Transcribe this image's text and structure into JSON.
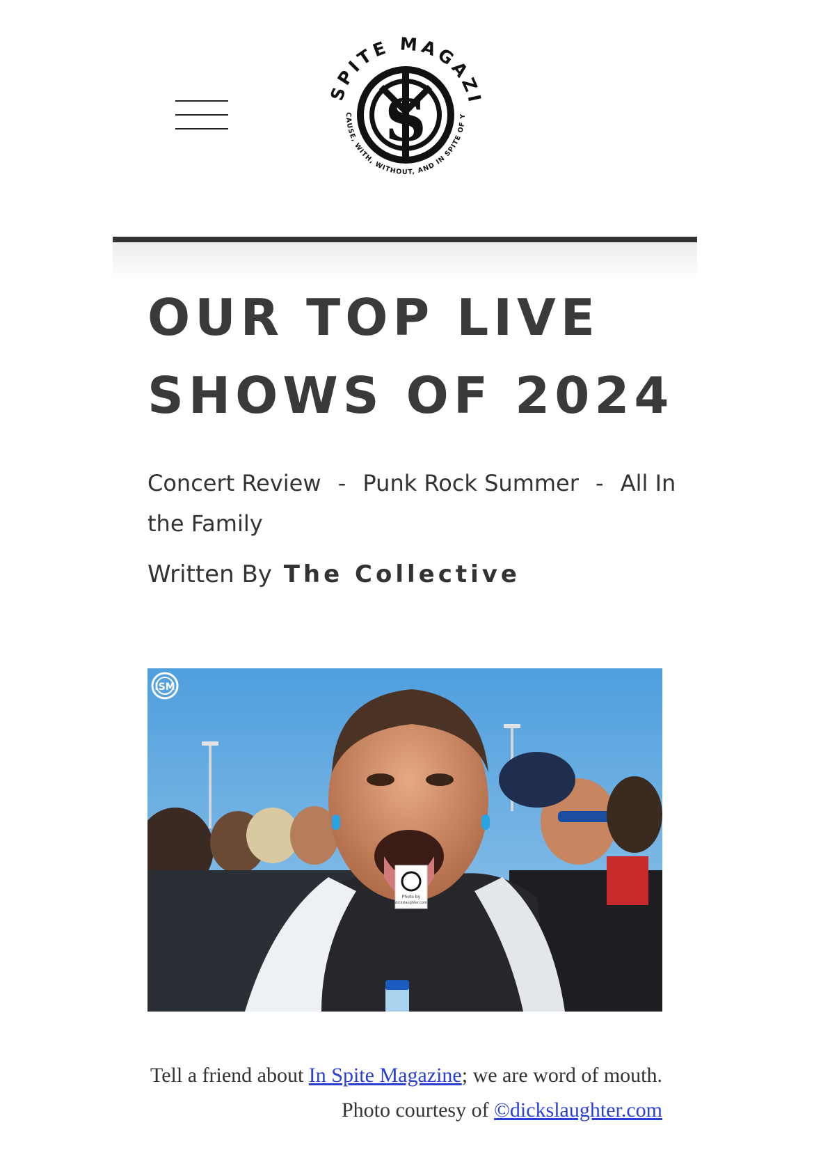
{
  "header": {
    "logo": {
      "ring_text": "IN SPITE MAGAZINE",
      "tagline": "BECAUSE, WITH, WITHOUT, AND IN SPITE OF YOU",
      "monogram": "ISM"
    },
    "menu_icon": "hamburger-icon"
  },
  "article": {
    "title_line1": "OUR TOP LIVE",
    "title_line2": "SHOWS OF 2024",
    "tags": [
      "Concert Review",
      "Punk Rock Summer",
      "All In the Family"
    ],
    "tag_separator": "-",
    "byline_prefix": "Written By",
    "author": "The Collective",
    "photo_watermark": "ISM",
    "photo_card": {
      "line1": "Photo by",
      "line2": "dickslaughter.com"
    },
    "caption": {
      "before_link": "Tell a friend about ",
      "link1": "In Spite Magazine",
      "middle": "; we are word of mouth. Photo courtesy of ",
      "link2": "©dickslaughter.com"
    }
  },
  "colors": {
    "text": "#333333",
    "link": "#2a3fd4",
    "sky": "#5fa7dd"
  }
}
